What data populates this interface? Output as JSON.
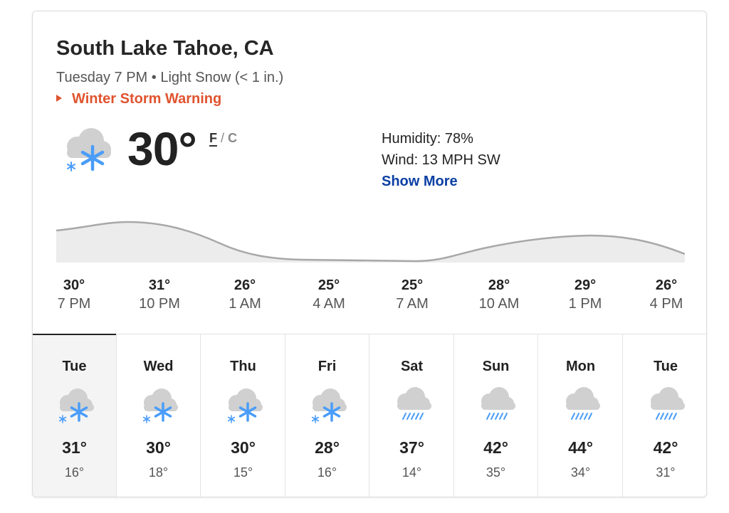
{
  "location": "South Lake Tahoe, CA",
  "summary": "Tuesday 7 PM • Light Snow (< 1 in.)",
  "alert": "Winter Storm Warning",
  "current": {
    "temp": "30°",
    "unit_f": "F",
    "unit_sep": "/",
    "unit_c": "C",
    "icon": "snow-icon",
    "humidity": "Humidity: 78%",
    "wind": "Wind: 13 MPH SW",
    "show_more": "Show More"
  },
  "colors": {
    "alert": "#e0532e",
    "link": "#0b3fa3",
    "snow": "#4a9df8",
    "cloud": "#cfcfcf"
  },
  "hourly": [
    {
      "temp": "30°",
      "time": "7 PM"
    },
    {
      "temp": "31°",
      "time": "10 PM"
    },
    {
      "temp": "26°",
      "time": "1 AM"
    },
    {
      "temp": "25°",
      "time": "4 AM"
    },
    {
      "temp": "25°",
      "time": "7 AM"
    },
    {
      "temp": "28°",
      "time": "10 AM"
    },
    {
      "temp": "29°",
      "time": "1 PM"
    },
    {
      "temp": "26°",
      "time": "4 PM"
    }
  ],
  "daily": [
    {
      "day": "Tue",
      "icon": "snow-icon",
      "high": "31°",
      "low": "16°",
      "selected": true
    },
    {
      "day": "Wed",
      "icon": "snow-icon",
      "high": "30°",
      "low": "18°"
    },
    {
      "day": "Thu",
      "icon": "snow-icon",
      "high": "30°",
      "low": "15°"
    },
    {
      "day": "Fri",
      "icon": "snow-icon",
      "high": "28°",
      "low": "16°"
    },
    {
      "day": "Sat",
      "icon": "rain-icon",
      "high": "37°",
      "low": "14°"
    },
    {
      "day": "Sun",
      "icon": "rain-icon",
      "high": "42°",
      "low": "35°"
    },
    {
      "day": "Mon",
      "icon": "rain-icon",
      "high": "44°",
      "low": "34°"
    },
    {
      "day": "Tue",
      "icon": "rain-icon",
      "high": "42°",
      "low": "31°"
    }
  ]
}
